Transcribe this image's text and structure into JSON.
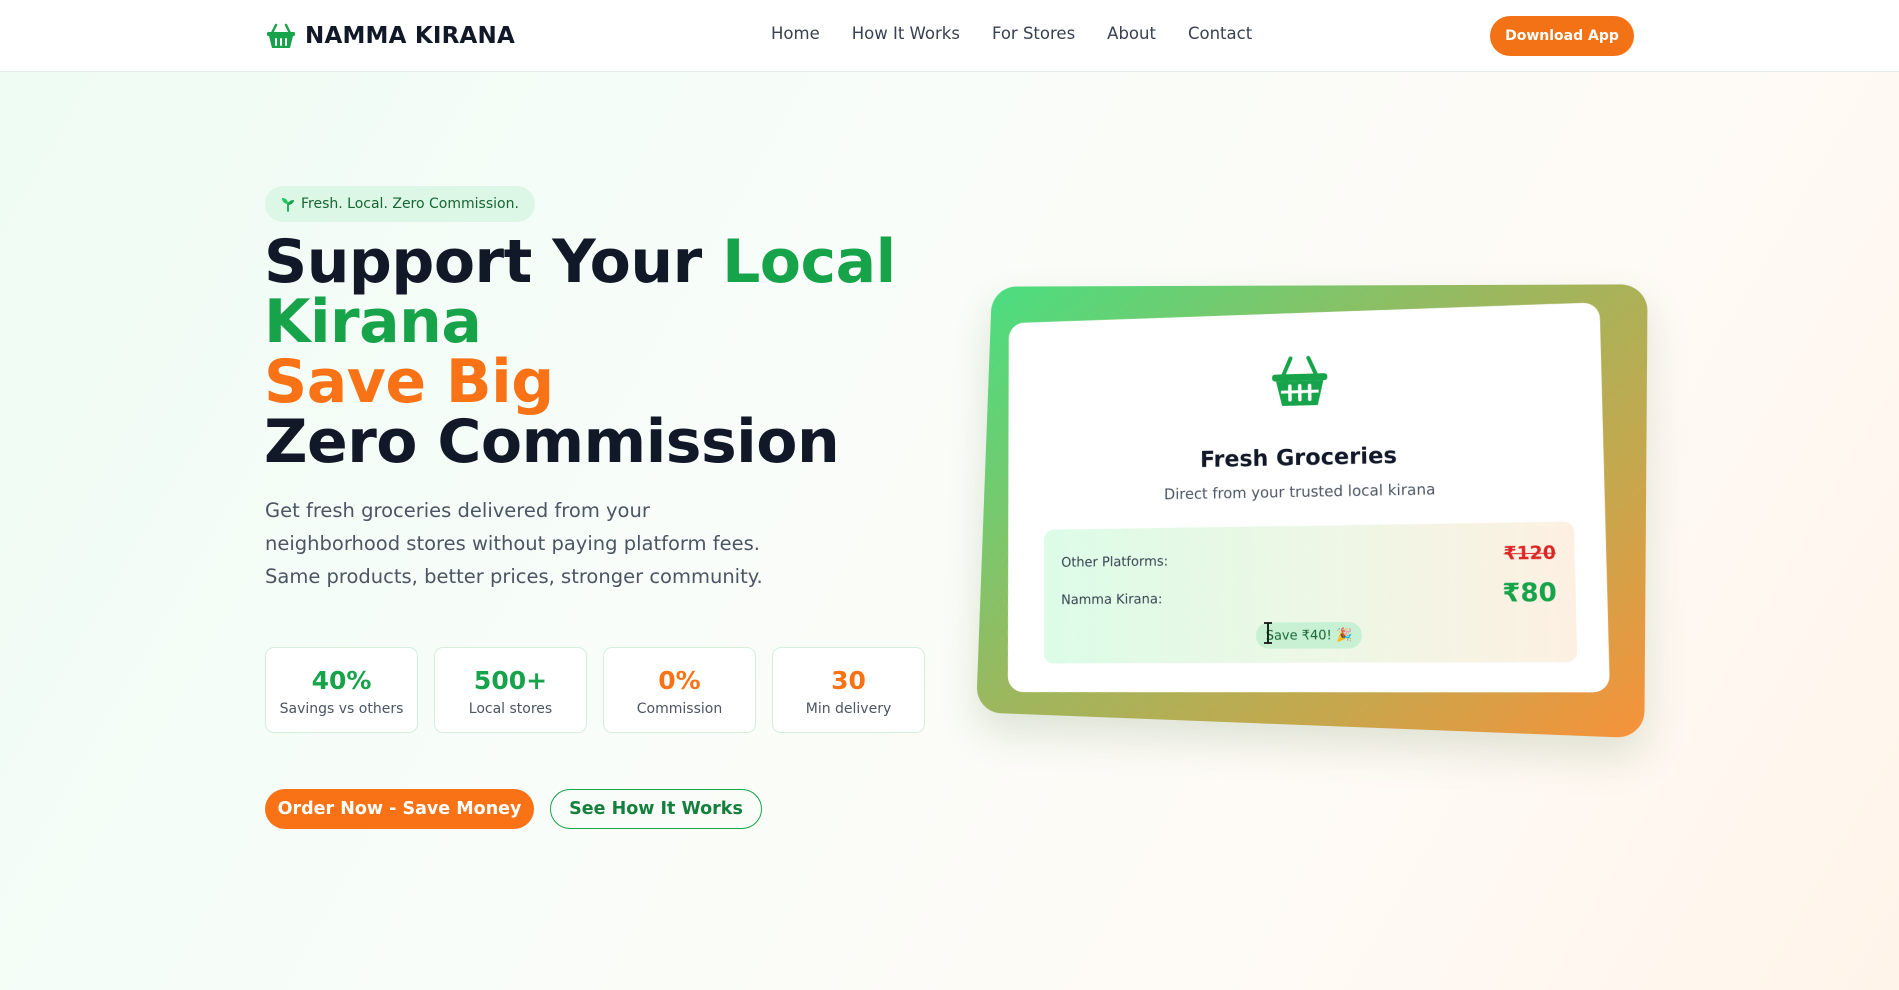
{
  "nav": {
    "brand": "NAMMA KIRANA",
    "brand_icon": "shopping-basket-icon",
    "links": [
      "Home",
      "How It Works",
      "For Stores",
      "About",
      "Contact"
    ],
    "cta": "Download App"
  },
  "hero": {
    "tag": "Fresh. Local. Zero Commission.",
    "tag_icon": "sprout-icon",
    "headline": {
      "part1": "Support Your ",
      "part2": "Local",
      "part3": "Kirana",
      "part4": "Save Big",
      "part5": "Zero Commission"
    },
    "subtitle": "Get fresh groceries delivered from your neighborhood stores without paying platform fees. Same products, better prices, stronger community.",
    "stats": [
      {
        "value": "40%",
        "label": "Savings vs others",
        "color": "#16a34a"
      },
      {
        "value": "500+",
        "label": "Local stores",
        "color": "#16a34a"
      },
      {
        "value": "0%",
        "label": "Commission",
        "color": "#f97316"
      },
      {
        "value": "30",
        "label": "Min delivery",
        "color": "#f97316"
      }
    ],
    "primary_button": "Order Now - Save Money",
    "secondary_button": "See How It Works"
  },
  "card": {
    "icon": "shopping-basket-icon",
    "title": "Fresh Groceries",
    "subtitle": "Direct from your trusted local kirana",
    "other_label": "Other Platforms:",
    "other_price": "₹120",
    "namma_label": "Namma Kirana:",
    "namma_price": "₹80",
    "savings": "Save ₹40! 🎉"
  },
  "colors": {
    "accent_green": "#16a34a",
    "accent_orange": "#f97316",
    "text_dark": "#111827"
  }
}
